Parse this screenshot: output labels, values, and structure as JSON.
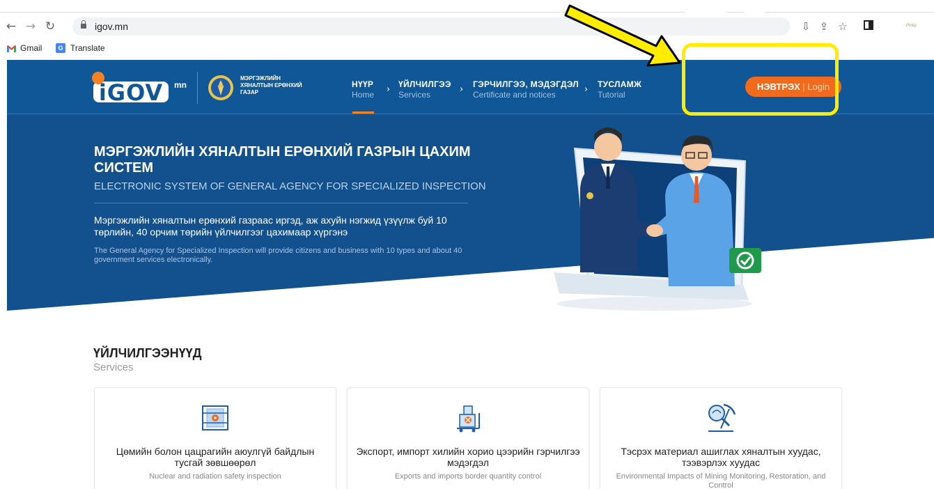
{
  "browser": {
    "url": "igov.mn",
    "bookmarks": [
      {
        "label": "Gmail"
      },
      {
        "label": "Translate"
      }
    ],
    "profile_label": "Pinky"
  },
  "header": {
    "logo_text": "iGOV",
    "logo_suffix": "mn",
    "agency_lines": [
      "МЭРГЭЖЛИЙН",
      "ХЯНАЛТЫН ЕРӨНХИЙ",
      "ГАЗАР"
    ],
    "nav": [
      {
        "mn": "НҮҮР",
        "en": "Home"
      },
      {
        "mn": "ҮЙЛЧИЛГЭЭ",
        "en": "Services"
      },
      {
        "mn": "ГЭРЧИЛГЭЭ, МЭДЭГДЭЛ",
        "en": "Certificate and notices"
      },
      {
        "mn": "ТУСЛАМЖ",
        "en": "Tutorial"
      }
    ],
    "login": {
      "mn": "НЭВТРЭХ",
      "sep": " | ",
      "en": "Login"
    }
  },
  "hero": {
    "title": "МЭРГЭЖЛИЙН ХЯНАЛТЫН ЕРӨНХИЙ ГАЗРЫН ЦАХИМ СИСТЕМ",
    "subtitle": "ELECTRONIC SYSTEM OF GENERAL AGENCY FOR SPECIALIZED INSPECTION",
    "description": "Мэргэжлийн хяналтын ерөнхий газраас иргэд, аж ахуйн нэгжид үзүүлж буй 10 төрлийн, 40 орчим төрийн үйлчилгээг цахимаар хүргэнэ",
    "description_en": "The General Agency for Specialized Inspection will provide citizens and business with 10 types and about 40 government services electronically."
  },
  "services": {
    "title": "ҮЙЛЧИЛГЭЭНҮҮД",
    "subtitle": "Services",
    "cards": [
      {
        "title": "Цөмийн болон цацрагийн аюулгүй байдлын тусгай зөвшөөрөл",
        "subtitle": "Nuclear and radiation safety inspection",
        "icon": "radiation-icon"
      },
      {
        "title": "Экспорт, импорт хилийн хорио цээрийн гэрчилгээ мэдэгдэл",
        "subtitle": "Exports and imports border quantity control",
        "icon": "cargo-icon"
      },
      {
        "title": "Тэсрэх материал ашиглах хяналтын хуудас, тээвэрлэх хуудас",
        "subtitle": "Environmental Impacts of Mining Monitoring, Restoration, and Control",
        "icon": "mining-icon"
      }
    ]
  },
  "colors": {
    "header_bg": "#0f5796",
    "accent": "#f26b1d",
    "highlight": "#ffec00"
  }
}
